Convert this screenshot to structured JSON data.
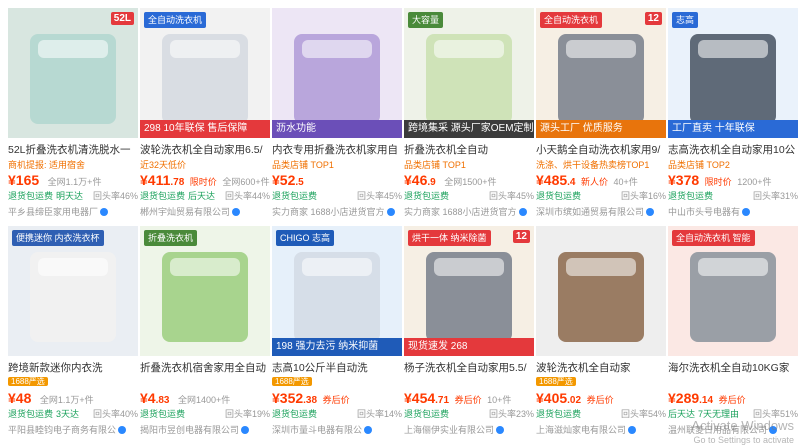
{
  "watermark": {
    "line1": "Activate Windows",
    "line2": "Go to Settings to activate"
  },
  "cards": [
    {
      "img_top": "52L",
      "img_banner": "",
      "img_bottom": "",
      "title": "52L折叠洗衣机清洗脱水一",
      "sub1": "商机提报: 适用宿舍",
      "sub_tag": "",
      "price_int": "¥165",
      "price_dec": "",
      "price_extra": "",
      "total_label": "全网1.1万+件",
      "badges": [
        "退货包运费",
        "明天达"
      ],
      "rate": "回头率46%",
      "shop": "平乡县缔臣家用电器厂",
      "colors": {
        "bg": "#d8e6e0",
        "prod": "#b7d9d2",
        "banner": "#e4393c",
        "bottom": "#e4393c"
      }
    },
    {
      "img_top": "",
      "img_banner": "全自动洗衣机",
      "img_bottom": "298 10年联保 售后保障",
      "title": "波轮洗衣机全自动家用6.5/",
      "sub1": "近32天低价",
      "sub_tag": "",
      "price_int": "¥411",
      "price_dec": ".78",
      "price_extra": "限时价",
      "total_label": "全网600+件",
      "badges": [
        "退货包运费",
        "后天达"
      ],
      "rate": "回头率44%",
      "shop": "郴州宇灿贸易有限公司",
      "colors": {
        "bg": "#f2f2f2",
        "prod": "#d9dde3",
        "banner": "#2a6ad6",
        "bottom": "#e4393c"
      }
    },
    {
      "img_top": "",
      "img_banner": "",
      "img_bottom": "沥水功能",
      "title": "内衣专用折叠洗衣机家用自",
      "sub1": "品类店铺 TOP1",
      "sub_tag": "",
      "price_int": "¥52",
      "price_dec": ".5",
      "price_extra": "",
      "total_label": "",
      "badges": [
        "退货包运费"
      ],
      "rate": "回头率45%",
      "shop": "实力商家 1688小店进货官方",
      "colors": {
        "bg": "#ede6f5",
        "prod": "#b9a6dc",
        "banner": "#7c5cc4",
        "bottom": "#6b4fb8"
      }
    },
    {
      "img_top": "",
      "img_banner": "大容量",
      "img_bottom": "跨境集采 源头厂家OEM定制",
      "title": "折叠洗衣机全自动",
      "sub1": "品类店铺 TOP1",
      "sub_tag": "",
      "price_int": "¥46",
      "price_dec": ".9",
      "price_extra": "",
      "total_label": "全网1500+件",
      "badges": [
        "退货包运费"
      ],
      "rate": "回头率45%",
      "shop": "实力商家 1688小店进货官方",
      "colors": {
        "bg": "#eef2e8",
        "prod": "#cfe3b8",
        "banner": "#4a8a3a",
        "bottom": "#3c3c3c"
      }
    },
    {
      "img_top": "12",
      "img_banner": "全自动洗衣机",
      "img_bottom": "源头工厂 优质服务",
      "title": "小天鹅全自动洗衣机家用9/",
      "sub1": "洗涤、烘干设备热卖榜TOP1",
      "sub_tag": "",
      "price_int": "¥485",
      "price_dec": ".4",
      "price_extra": "新人价",
      "total_label": "40+件",
      "badges": [
        "退货包运费"
      ],
      "rate": "回头率16%",
      "shop": "深圳市缤如通贸易有限公司",
      "colors": {
        "bg": "#f6efe4",
        "prod": "#8a8f98",
        "banner": "#e4393c",
        "bottom": "#e8740c"
      }
    },
    {
      "img_top": "",
      "img_banner": "志高",
      "img_bottom": "工厂直卖 十年联保",
      "title": "志高洗衣机全自动家用10公",
      "sub1": "品类店铺 TOP2",
      "sub_tag": "",
      "price_int": "¥378",
      "price_dec": "",
      "price_extra": "限时价",
      "total_label": "1200+件",
      "badges": [
        "退货包运费"
      ],
      "rate": "回头率31%",
      "shop": "中山市头号电器有",
      "colors": {
        "bg": "#eaf2fb",
        "prod": "#5f6a78",
        "banner": "#2a6ad6",
        "bottom": "#2a6ad6"
      }
    },
    {
      "img_top": "",
      "img_banner": "便携迷你 内衣洗衣杯",
      "img_bottom": "",
      "title": "跨境新款迷你内衣洗",
      "sub1": "",
      "sub_tag": "1688严选",
      "price_int": "¥48",
      "price_dec": "",
      "price_extra": "",
      "total_label": "全网1.1万+件",
      "badges": [
        "退货包运费",
        "3天达"
      ],
      "rate": "回头率40%",
      "shop": "平阳县睦钧电子商务有限公",
      "colors": {
        "bg": "#eaeef3",
        "prod": "#f1f1f1",
        "banner": "#2f5fb3",
        "bottom": "#2f5fb3"
      }
    },
    {
      "img_top": "",
      "img_banner": "折叠洗衣机",
      "img_bottom": "",
      "title": "折叠洗衣机宿舍家用全自动",
      "sub1": "",
      "sub_tag": "",
      "price_int": "¥4",
      "price_dec": ".83",
      "price_extra": "",
      "total_label": "全网1400+件",
      "badges": [
        "退货包运费"
      ],
      "rate": "回头率19%",
      "shop": "揭阳市昱创电器有限公司",
      "colors": {
        "bg": "#eef5e8",
        "prod": "#a8d48e",
        "banner": "#4a8a3a",
        "bottom": "#4a8a3a"
      }
    },
    {
      "img_top": "",
      "img_banner": "CHIGO 志高",
      "img_bottom": "198 强力去污 纳米抑菌",
      "title": "志高10公斤半自动洗",
      "sub1": "",
      "sub_tag": "1688严选",
      "price_int": "¥352",
      "price_dec": ".38",
      "price_extra": "券后价",
      "total_label": "",
      "badges": [
        "退货包运费"
      ],
      "rate": "回头率14%",
      "shop": "深圳市量斗电器有限公",
      "colors": {
        "bg": "#e6f0fa",
        "prod": "#d6dee8",
        "banner": "#1f5bb8",
        "bottom": "#1f5bb8"
      }
    },
    {
      "img_top": "12",
      "img_banner": "烘干一体 纳米除菌",
      "img_bottom": "现货速发 268",
      "title": "杨子洗衣机全自动家用5.5/",
      "sub1": "",
      "sub_tag": "",
      "price_int": "¥454",
      "price_dec": ".71",
      "price_extra": "券后价",
      "total_label": "10+件",
      "badges": [
        "退货包运费"
      ],
      "rate": "回头率23%",
      "shop": "上海俪伊实业有限公司",
      "colors": {
        "bg": "#f6efe4",
        "prod": "#8a8f98",
        "banner": "#e4393c",
        "bottom": "#e4393c"
      }
    },
    {
      "img_top": "",
      "img_banner": "",
      "img_bottom": "",
      "title": "波轮洗衣机全自动家",
      "sub1": "",
      "sub_tag": "1688严选",
      "price_int": "¥405",
      "price_dec": ".02",
      "price_extra": "券后价",
      "total_label": "",
      "badges": [
        "退货包运费"
      ],
      "rate": "回头率54%",
      "shop": "上海滋灿家电有限公司",
      "colors": {
        "bg": "#eeeeee",
        "prod": "#9a7c63",
        "banner": "#9a7c63",
        "bottom": "#9a7c63"
      }
    },
    {
      "img_top": "",
      "img_banner": "全自动洗衣机 智能",
      "img_bottom": "",
      "title": "海尔洗衣机全自动10KG家",
      "sub1": "",
      "sub_tag": "",
      "price_int": "¥289",
      "price_dec": ".14",
      "price_extra": "券后价",
      "total_label": "",
      "badges": [
        "后天达",
        "7天无理由"
      ],
      "rate": "回头率51%",
      "shop": "温州联菱日用品有限公司",
      "colors": {
        "bg": "#fbe8e4",
        "prod": "#9a9fa6",
        "banner": "#e4393c",
        "bottom": "#e4393c"
      }
    }
  ]
}
